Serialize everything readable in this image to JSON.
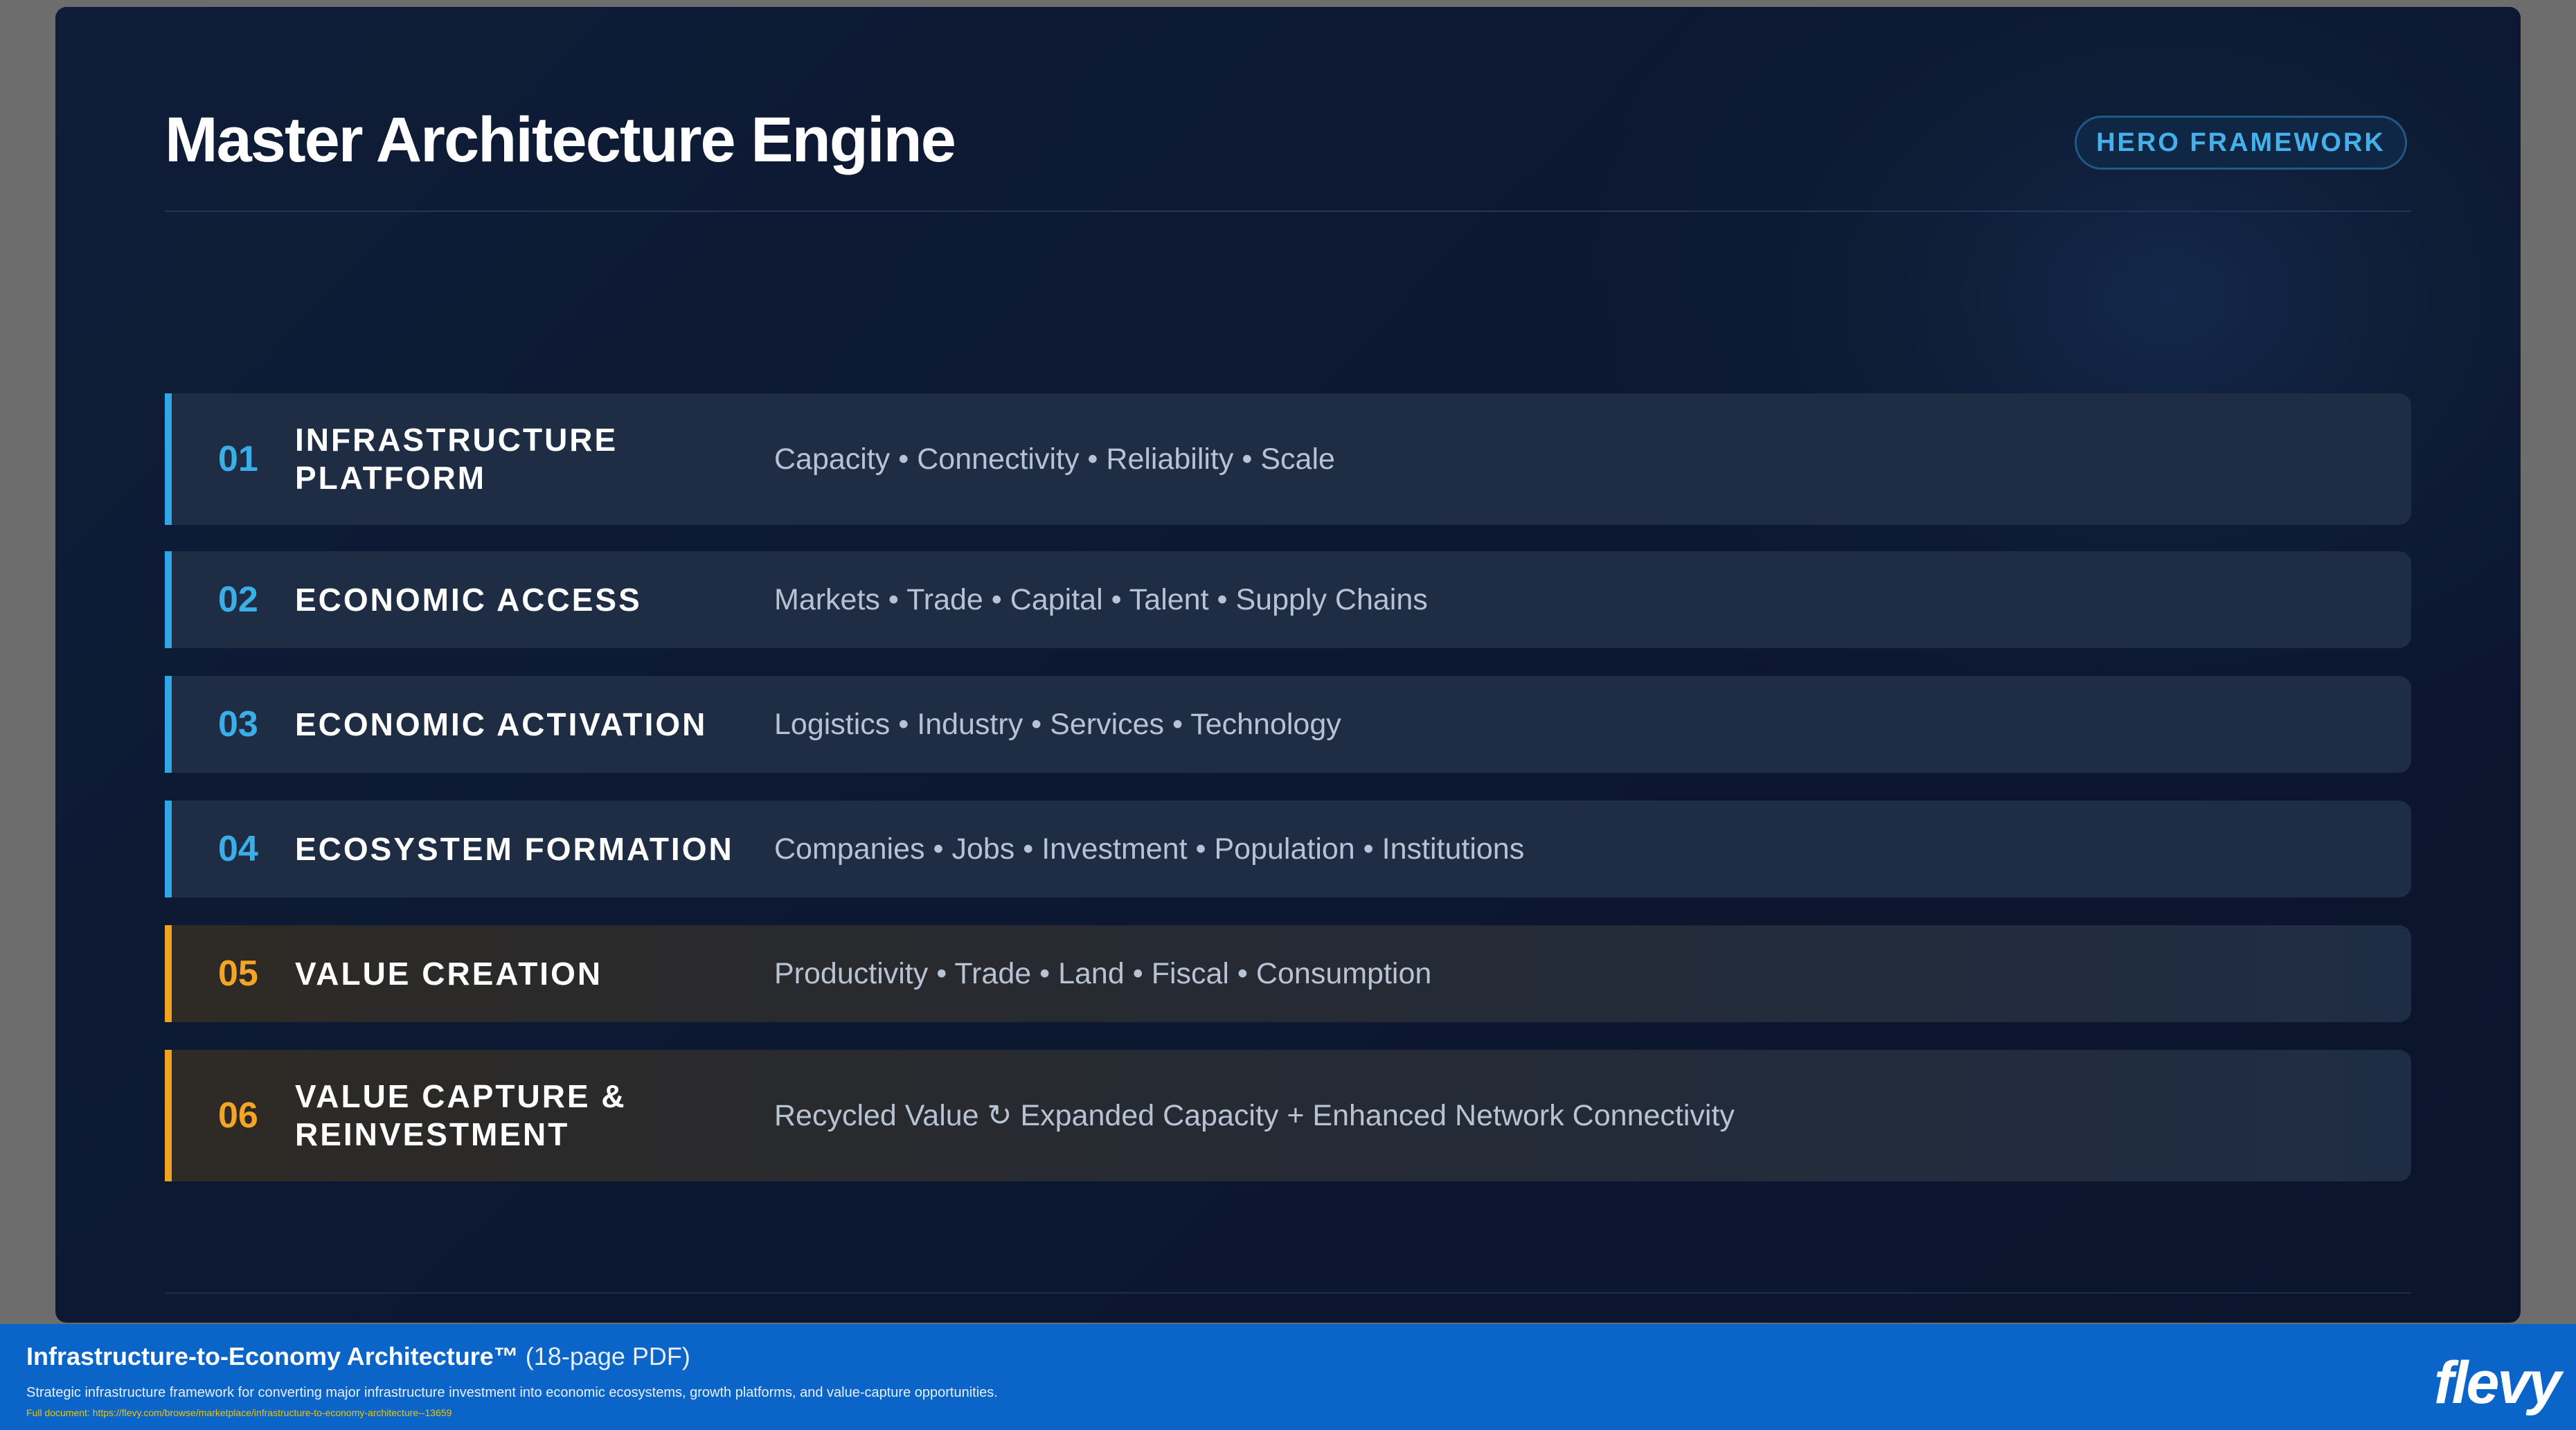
{
  "slide": {
    "title": "Master Architecture Engine",
    "badge": "HERO FRAMEWORK"
  },
  "rows": [
    {
      "num": "01",
      "name": "INFRASTRUCTURE PLATFORM",
      "desc": "Capacity • Connectivity • Reliability • Scale",
      "accent": "#2fa6e6"
    },
    {
      "num": "02",
      "name": "ECONOMIC ACCESS",
      "desc": "Markets • Trade • Capital • Talent • Supply Chains",
      "accent": "#2fa6e6"
    },
    {
      "num": "03",
      "name": "ECONOMIC ACTIVATION",
      "desc": "Logistics • Industry • Services • Technology",
      "accent": "#2fa6e6"
    },
    {
      "num": "04",
      "name": "ECOSYSTEM FORMATION",
      "desc": "Companies • Jobs • Investment • Population • Institutions",
      "accent": "#2fa6e6"
    },
    {
      "num": "05",
      "name": "VALUE CREATION",
      "desc": "Productivity • Trade • Land • Fiscal • Consumption",
      "accent": "#f2a222"
    },
    {
      "num": "06",
      "name": "VALUE CAPTURE & REINVESTMENT",
      "desc": "Recycled Value ↻ Expanded Capacity + Enhanced Network Connectivity",
      "accent": "#f2a222"
    }
  ],
  "banner": {
    "title": "Infrastructure-to-Economy Architecture™",
    "title_suffix": "(18-page PDF)",
    "description": "Strategic infrastructure framework for converting major infrastructure investment into economic ecosystems, growth platforms, and value-capture opportunities.",
    "link": "Full document: https://flevy.com/browse/marketplace/infrastructure-to-economy-architecture--13659",
    "logo": "flevy"
  }
}
